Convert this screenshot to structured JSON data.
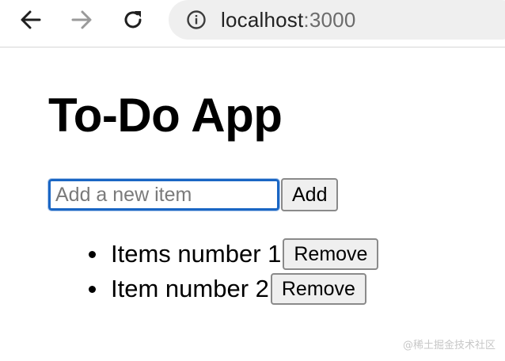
{
  "browser": {
    "back_icon": "arrow-left-icon",
    "forward_icon": "arrow-right-icon",
    "reload_icon": "reload-icon",
    "info_icon": "info-icon",
    "url_host": "localhost",
    "url_port": ":3000"
  },
  "app": {
    "title": "To-Do App",
    "input_placeholder": "Add a new item",
    "input_value": "",
    "add_label": "Add",
    "items": [
      {
        "text": "Items number 1",
        "remove_label": "Remove"
      },
      {
        "text": "Item number 2",
        "remove_label": "Remove"
      }
    ]
  },
  "watermark": "@稀土掘金技术社区",
  "colors": {
    "input_focus_border": "#1a66c4",
    "button_bg": "#efefef",
    "address_bar_bg": "#efefef"
  }
}
